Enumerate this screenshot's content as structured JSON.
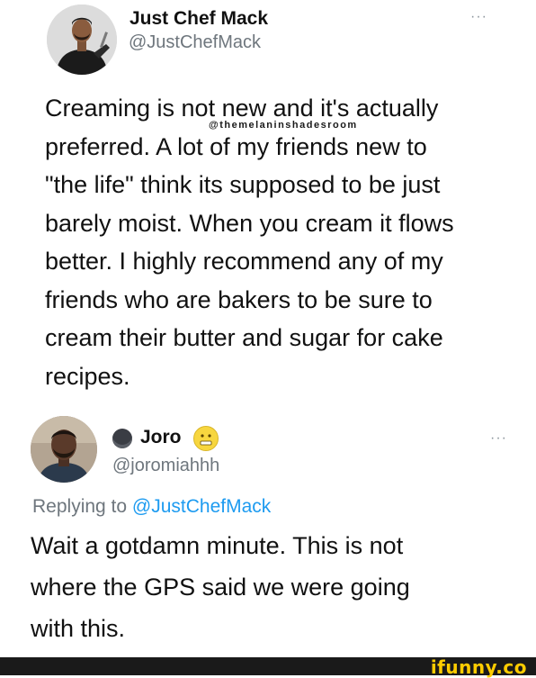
{
  "tweet": {
    "author_name": "Just Chef Mack",
    "author_handle": "@JustChefMack",
    "more_icon": "more-dots-icon",
    "more_label": "···",
    "lines": [
      "Creaming is not new and it's actually",
      "preferred. A lot of my friends new to",
      "\"the life\" think its supposed to be just",
      "barely moist. When you cream it flows",
      "better. I highly recommend any of my",
      "friends who are bakers to be sure to",
      "cream their butter and sugar for cake",
      "recipes."
    ],
    "watermark": "@themelaninshadesroom"
  },
  "reply": {
    "author_name": "Joro",
    "author_handle": "@joromiahhh",
    "name_badge_icon": "round-badge-icon",
    "name_emoji_icon": "grimace-emoji-icon",
    "more_label": "···",
    "replying_prefix": "Replying to",
    "replying_to": "@JustChefMack",
    "lines": [
      "Wait a gotdamn minute. This is not",
      "where the GPS said we were going",
      "with this."
    ]
  },
  "footer": {
    "brand": "ifunny.co"
  }
}
